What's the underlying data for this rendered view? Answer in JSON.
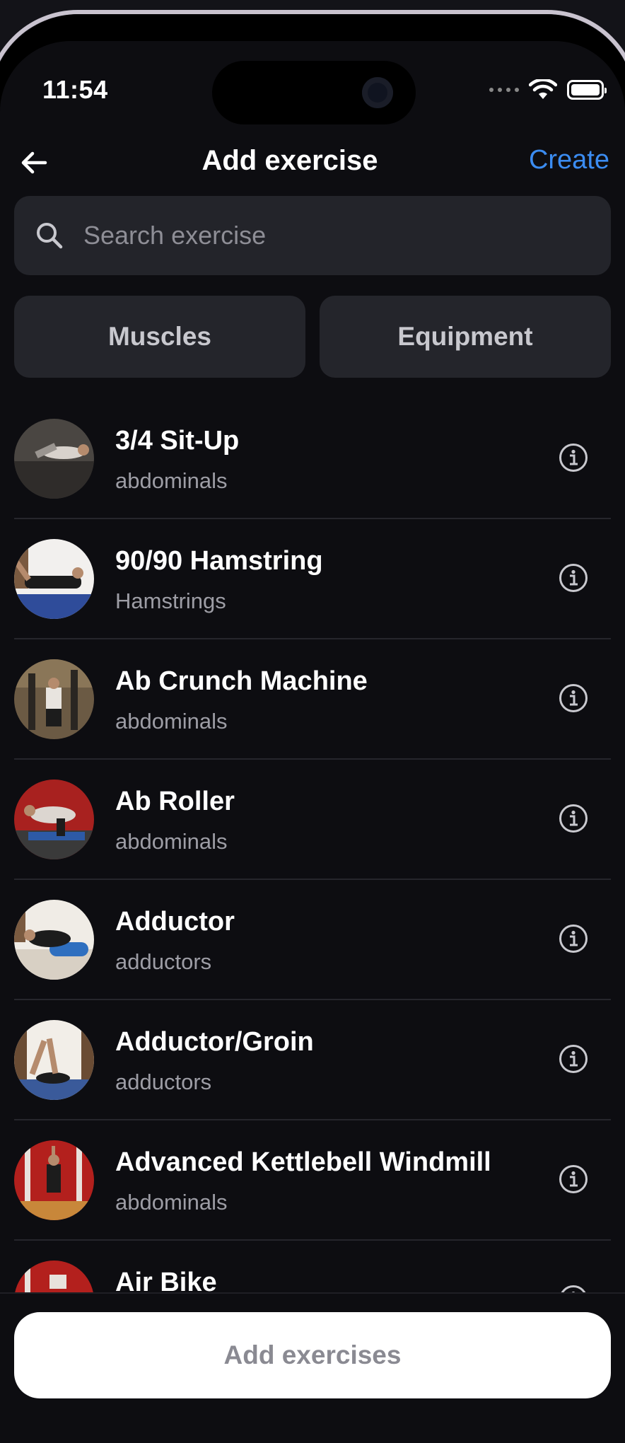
{
  "status": {
    "time": "11:54"
  },
  "nav": {
    "title": "Add exercise",
    "create_label": "Create"
  },
  "search": {
    "placeholder": "Search exercise"
  },
  "filters": {
    "muscles_label": "Muscles",
    "equipment_label": "Equipment"
  },
  "exercises": [
    {
      "name": "3/4 Sit-Up",
      "muscle": "abdominals"
    },
    {
      "name": "90/90 Hamstring",
      "muscle": "Hamstrings"
    },
    {
      "name": "Ab Crunch Machine",
      "muscle": "abdominals"
    },
    {
      "name": "Ab Roller",
      "muscle": "abdominals"
    },
    {
      "name": "Adductor",
      "muscle": "adductors"
    },
    {
      "name": "Adductor/Groin",
      "muscle": "adductors"
    },
    {
      "name": "Advanced Kettlebell Windmill",
      "muscle": "abdominals"
    },
    {
      "name": "Air Bike",
      "muscle": ""
    }
  ],
  "footer": {
    "add_label": "Add exercises"
  },
  "colors": {
    "accent": "#3b8cf1",
    "background": "#0d0d11",
    "surface": "#24252b"
  }
}
